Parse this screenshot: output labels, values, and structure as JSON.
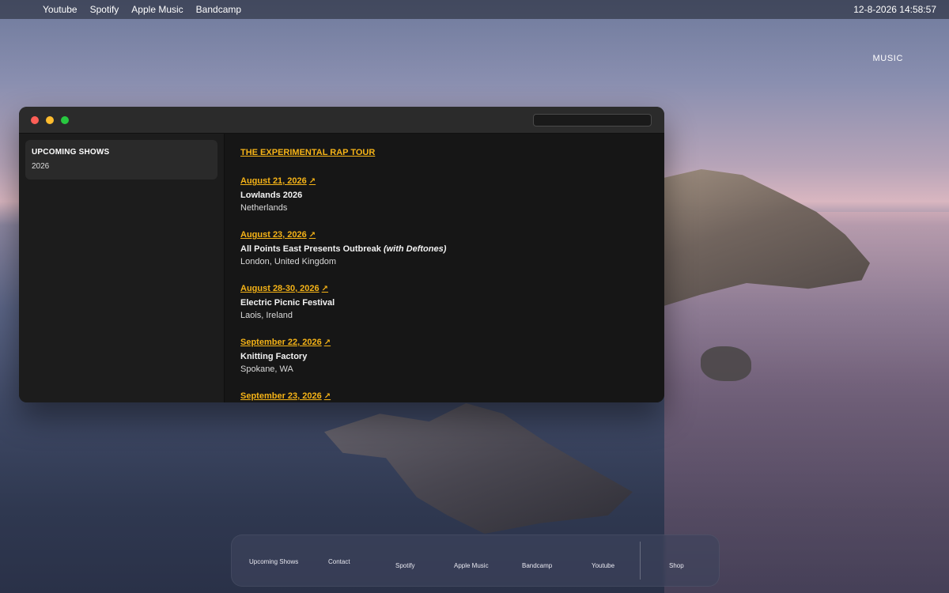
{
  "menubar": {
    "links": [
      "Youtube",
      "Spotify",
      "Apple Music",
      "Bandcamp"
    ],
    "datetime": "12-8-2026 14:58:57"
  },
  "desktop": {
    "music_label": "MUSIC"
  },
  "window": {
    "search": {
      "placeholder": "",
      "value": ""
    },
    "sidebar": {
      "items": [
        {
          "title": "UPCOMING SHOWS",
          "subtitle": "2026"
        }
      ]
    },
    "main": {
      "tour_title": "THE EXPERIMENTAL RAP TOUR",
      "shows": [
        {
          "date": "August 21, 2026",
          "venue": "Lowlands 2026",
          "with": "",
          "location": "Netherlands"
        },
        {
          "date": "August 23, 2026",
          "venue": "All Points East Presents Outbreak",
          "with": "(with Deftones)",
          "location": "London, United Kingdom"
        },
        {
          "date": "August 28-30, 2026",
          "venue": "Electric Picnic Festival",
          "with": "",
          "location": "Laois, Ireland"
        },
        {
          "date": "September 22, 2026",
          "venue": "Knitting Factory",
          "with": "",
          "location": "Spokane, WA"
        },
        {
          "date": "September 23, 2026",
          "venue": "",
          "with": "",
          "location": ""
        }
      ]
    }
  },
  "dock": {
    "items": [
      "Upcoming Shows",
      "Contact",
      "Spotify",
      "Apple Music",
      "Bandcamp",
      "Youtube",
      "Shop"
    ]
  },
  "colors": {
    "accent": "#f5b317",
    "window_bg": "#1f1f1f",
    "traffic_red": "#ff5f57",
    "traffic_yellow": "#febc2e",
    "traffic_green": "#28c840"
  },
  "icons": {
    "external_link": "arrow-up-right-icon"
  }
}
